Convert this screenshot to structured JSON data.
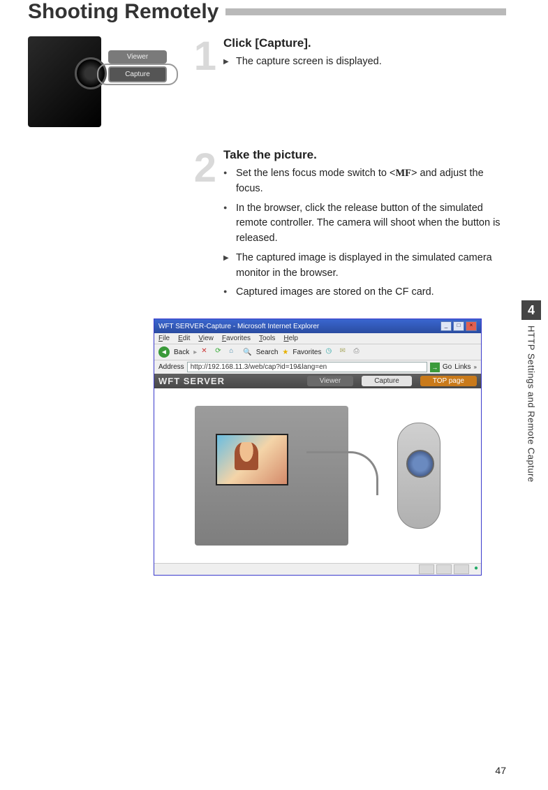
{
  "heading": "Shooting Remotely",
  "steps": [
    {
      "num": "1",
      "title": "Click [Capture].",
      "items": [
        {
          "type": "arrow",
          "text": "The capture screen is displayed."
        }
      ],
      "viewer_label": "Viewer",
      "capture_label": "Capture"
    },
    {
      "num": "2",
      "title": "Take the picture.",
      "items": [
        {
          "type": "bullet",
          "pre": "Set the lens focus mode switch to <",
          "mf": "MF",
          "post": "> and adjust the focus."
        },
        {
          "type": "bullet",
          "text": "In the browser, click the release button of the simulated remote controller. The camera will shoot when the button is released."
        },
        {
          "type": "arrow",
          "text": "The captured image is displayed in the simulated camera monitor in the browser."
        },
        {
          "type": "bullet",
          "text": "Captured images are stored on the CF card."
        }
      ]
    }
  ],
  "browser": {
    "title": "WFT SERVER-Capture - Microsoft Internet Explorer",
    "menu": [
      "File",
      "Edit",
      "View",
      "Favorites",
      "Tools",
      "Help"
    ],
    "back": "Back",
    "search": "Search",
    "favorites": "Favorites",
    "address_label": "Address",
    "address_url": "http://192.168.11.3/web/cap?id=19&lang=en",
    "go": "Go",
    "links": "Links",
    "wft_name": "WFT SERVER",
    "wft_viewer": "Viewer",
    "wft_capture": "Capture",
    "wft_top": "TOP page"
  },
  "side": {
    "num": "4",
    "text": "HTTP Settings and Remote Capture"
  },
  "page_num": "47"
}
